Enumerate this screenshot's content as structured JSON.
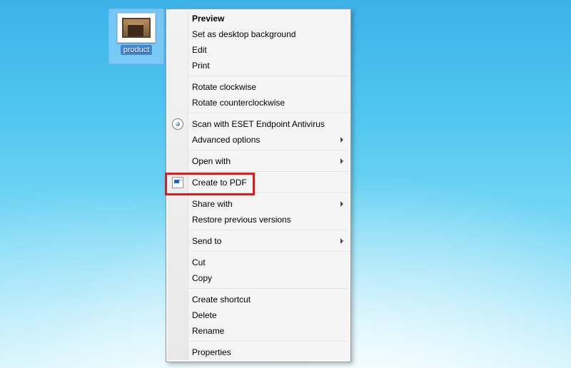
{
  "desktop": {
    "file_label": "product"
  },
  "menu": {
    "preview": "Preview",
    "set_bg": "Set as desktop background",
    "edit": "Edit",
    "print": "Print",
    "rotate_cw": "Rotate clockwise",
    "rotate_ccw": "Rotate counterclockwise",
    "eset_scan": "Scan with ESET Endpoint Antivirus",
    "advanced": "Advanced options",
    "open_with": "Open with",
    "create_pdf": "Create to PDF",
    "share_with": "Share with",
    "restore": "Restore previous versions",
    "send_to": "Send to",
    "cut": "Cut",
    "copy": "Copy",
    "create_shortcut": "Create shortcut",
    "delete": "Delete",
    "rename": "Rename",
    "properties": "Properties"
  },
  "annotation": {
    "highlight_target": "create_pdf"
  }
}
